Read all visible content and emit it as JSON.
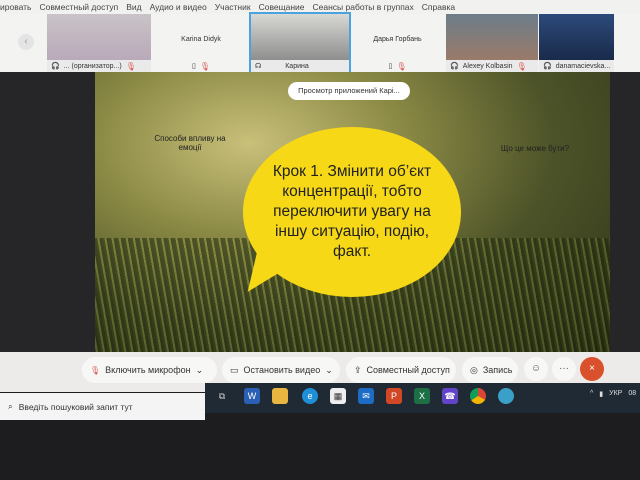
{
  "menu": [
    "ировать",
    "Совместный доступ",
    "Вид",
    "Аудио и видео",
    "Участник",
    "Совещание",
    "Сеансы работы в группах",
    "Справка"
  ],
  "participants": [
    {
      "name": "... (организатор...)",
      "type": "video"
    },
    {
      "name": "Karina Didyk",
      "type": "avatar"
    },
    {
      "name": "Карина",
      "type": "video",
      "active": true
    },
    {
      "name": "Дарья Горбань",
      "type": "avatar"
    },
    {
      "name": "Alexey Kolbasin",
      "type": "video"
    },
    {
      "name": "danamacievska...",
      "type": "video"
    }
  ],
  "pill": "Просмотр приложений Карі...",
  "slide": {
    "left_text": "Способи впливу на емоції",
    "right_text": "Що це може бути?",
    "bubble": "Крок 1. Змінити об’єкт концентрації, тобто переключити увагу на іншу ситуацію, подію, факт.",
    "bubble_color": "#f6d816"
  },
  "controls": {
    "mic": "Включить микрофон",
    "video": "Остановить видео",
    "share": "Совместный доступ",
    "record": "Запись",
    "more": "···",
    "leave": "×"
  },
  "taskbar": {
    "search_placeholder": "Введіть пошуковий запит тут",
    "lang": "УКР",
    "time": "08"
  }
}
